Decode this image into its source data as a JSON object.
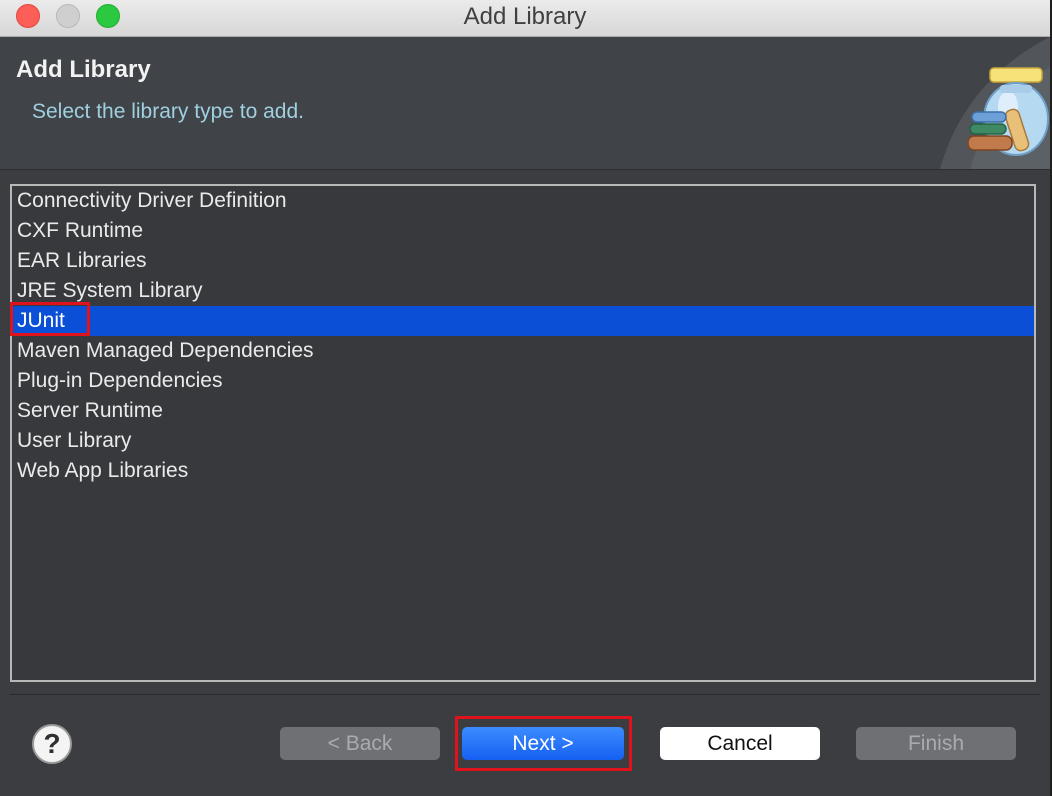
{
  "window": {
    "title": "Add Library"
  },
  "header": {
    "title": "Add Library",
    "description": "Select the library type to add."
  },
  "library_list": {
    "items": [
      "Connectivity Driver Definition",
      "CXF Runtime",
      "EAR Libraries",
      "JRE System Library",
      "JUnit",
      "Maven Managed Dependencies",
      "Plug-in Dependencies",
      "Server Runtime",
      "User Library",
      "Web App Libraries"
    ],
    "selected": "JUnit"
  },
  "buttons": {
    "help": "?",
    "back": "< Back",
    "next": "Next >",
    "cancel": "Cancel",
    "finish": "Finish"
  },
  "colors": {
    "selection": "#0a4fd6",
    "highlight_box": "#e0121c",
    "description": "#9fd0e0"
  },
  "icons": {
    "banner": "library-jar-icon",
    "help": "help-icon"
  }
}
